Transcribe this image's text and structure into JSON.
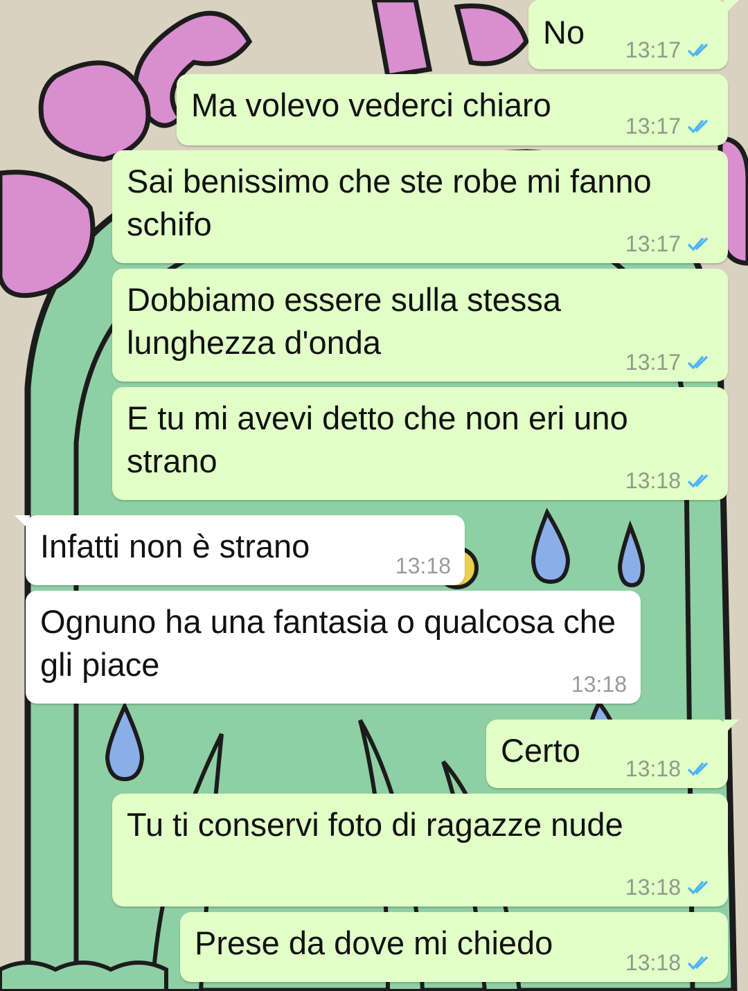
{
  "chat": {
    "messages": [
      {
        "dir": "out",
        "text": "No",
        "time": "13:17",
        "read": true
      },
      {
        "dir": "out",
        "text": "Ma volevo vederci chiaro",
        "time": "13:17",
        "read": true
      },
      {
        "dir": "out",
        "text": "Sai benissimo che ste robe mi fanno schifo",
        "time": "13:17",
        "read": true
      },
      {
        "dir": "out",
        "text": "Dobbiamo essere sulla stessa lunghezza d'onda",
        "time": "13:17",
        "read": true
      },
      {
        "dir": "out",
        "text": "E tu mi avevi detto che non eri uno strano",
        "time": "13:18",
        "read": true
      },
      {
        "dir": "in",
        "text": "Infatti non è strano",
        "time": "13:18"
      },
      {
        "dir": "in",
        "text": "Ognuno ha una fantasia o qualcosa che gli piace",
        "time": "13:18"
      },
      {
        "dir": "out",
        "text": "Certo",
        "time": "13:18",
        "read": true
      },
      {
        "dir": "out",
        "text": "Tu ti conservi foto di ragazze nude",
        "time": "13:18",
        "read": true
      },
      {
        "dir": "out",
        "text": "Prese da dove mi chiedo",
        "time": "13:18",
        "read": true
      }
    ]
  },
  "colors": {
    "outgoing_bubble": "#e1ffc7",
    "incoming_bubble": "#ffffff",
    "read_ticks": "#4fb5f5",
    "wallpaper_bg": "#d9d2c0",
    "wallpaper_green": "#8fcfa4",
    "wallpaper_pink": "#d98fcf",
    "wallpaper_blue": "#8aaee8"
  },
  "icons": {
    "read_receipt": "double-check-icon"
  }
}
